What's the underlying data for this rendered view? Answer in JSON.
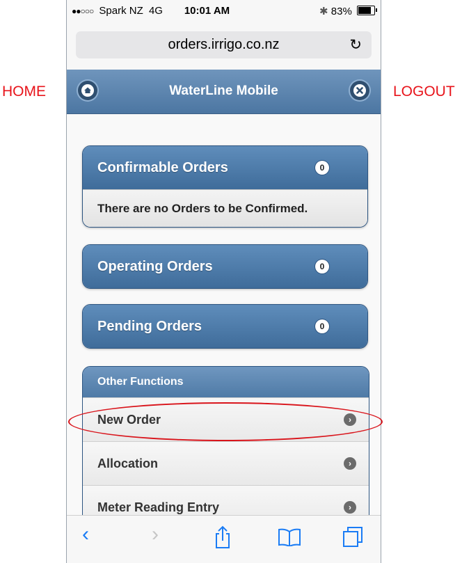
{
  "status_bar": {
    "signal": "●●○○○",
    "carrier": "Spark NZ",
    "network": "4G",
    "time": "10:01 AM",
    "bluetooth_icon": "bluetooth-icon",
    "battery": "83%",
    "battery_level": 0.83
  },
  "browser": {
    "url": "orders.irrigo.co.nz",
    "reload_icon": "reload-icon"
  },
  "header": {
    "title": "WaterLine Mobile",
    "home_icon": "home-icon",
    "logout_icon": "close-icon"
  },
  "annotations": {
    "home_label": "HOME",
    "logout_label": "LOGOUT",
    "color": "#e8141b"
  },
  "cards": [
    {
      "title": "Confirmable Orders",
      "count": "0",
      "message": "There are no Orders to be Confirmed."
    },
    {
      "title": "Operating Orders",
      "count": "0"
    },
    {
      "title": "Pending Orders",
      "count": "0"
    }
  ],
  "other_functions": {
    "title": "Other Functions",
    "items": [
      {
        "label": "New Order"
      },
      {
        "label": "Allocation"
      },
      {
        "label": "Meter Reading Entry"
      }
    ]
  },
  "toolbar": {
    "back_icon": "back-icon",
    "forward_icon": "forward-icon",
    "share_icon": "share-icon",
    "bookmarks_icon": "bookmarks-icon",
    "tabs_icon": "tabs-icon"
  },
  "colors": {
    "header": "#4c76a2",
    "card": "#3f6c9a",
    "accent_link": "#1a7cf5"
  }
}
